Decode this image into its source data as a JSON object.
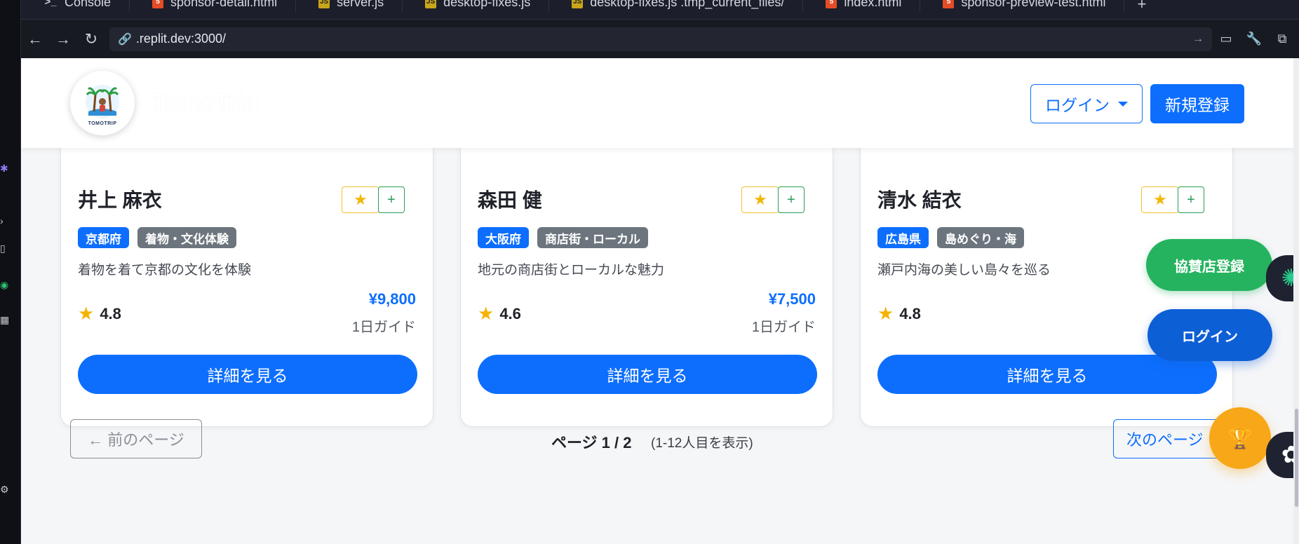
{
  "browser": {
    "tabs": [
      {
        "label": "Console",
        "icon": "terminal-icon"
      },
      {
        "label": "sponsor-detail.html",
        "icon": "html-file-icon"
      },
      {
        "label": "server.js",
        "icon": "js-file-icon"
      },
      {
        "label": "desktop-fixes.js",
        "icon": "js-file-icon"
      },
      {
        "label": "desktop-fixes.js .tmp_current_files/",
        "icon": "js-file-icon"
      },
      {
        "label": "index.html",
        "icon": "html-file-icon"
      },
      {
        "label": "sponsor-preview-test.html",
        "icon": "html-file-icon"
      }
    ],
    "url": ".replit.dev:3000/"
  },
  "header": {
    "brand": "TomoTrip",
    "logo_text": "TOMOTRIP",
    "login_label": "ログイン",
    "signup_label": "新規登録"
  },
  "cards": [
    {
      "name": "井上 麻衣",
      "region": "京都府",
      "category": "着物・文化体験",
      "description": "着物を着て京都の文化を体験",
      "rating": "4.8",
      "price": "¥9,800",
      "unit": "1日ガイド",
      "button": "詳細を見る"
    },
    {
      "name": "森田 健",
      "region": "大阪府",
      "category": "商店街・ローカル",
      "description": "地元の商店街とローカルな魅力",
      "rating": "4.6",
      "price": "¥7,500",
      "unit": "1日ガイド",
      "button": "詳細を見る"
    },
    {
      "name": "清水 結衣",
      "region": "広島県",
      "category": "島めぐり・海",
      "description": "瀬戸内海の美しい島々を巡る",
      "rating": "4.8",
      "price": "",
      "unit": "",
      "button": "詳細を見る"
    }
  ],
  "pagination": {
    "prev_label": "← 前のページ",
    "page_info": "ページ 1 / 2",
    "range": "(1-12人目を表示)",
    "next_label": "次のページ"
  },
  "floating": {
    "sponsor_label": "協賛店登録",
    "login_label": "ログイン"
  },
  "colors": {
    "primary": "#0d6efd",
    "success": "#25b35f",
    "warning": "#f7a718"
  }
}
